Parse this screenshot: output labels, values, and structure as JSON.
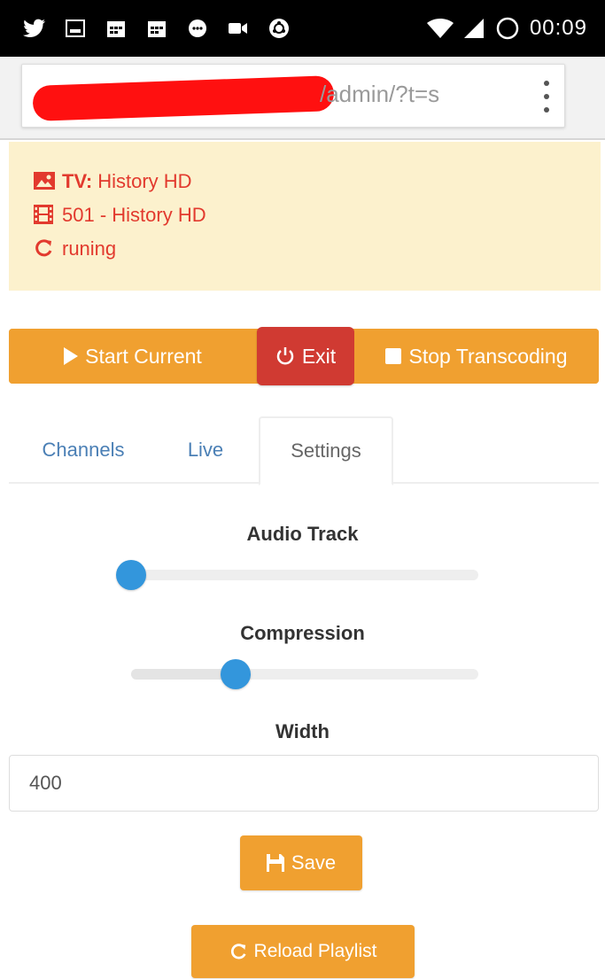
{
  "status_bar": {
    "time": "00:09",
    "left_icons": [
      "twitter-icon",
      "gallery-icon",
      "calendar-icon",
      "calendar-icon",
      "chat-icon",
      "video-icon",
      "ubuntu-icon"
    ],
    "right_icons": [
      "wifi-icon",
      "signal-icon",
      "sync-icon"
    ]
  },
  "browser": {
    "url_visible": "/admin/?t=s",
    "menu_icon": "overflow-menu-icon"
  },
  "info_panel": {
    "tv_label": "TV:",
    "tv_value": "History HD",
    "channel": "501 - History HD",
    "status": "runing",
    "text_color": "#e23a2e",
    "background": "#fcf1cd"
  },
  "actions": {
    "start_label": "Start Current",
    "exit_label": "Exit",
    "stop_label": "Stop Transcoding",
    "accent": "#f0a030",
    "danger": "#d03a32"
  },
  "tabs": {
    "channels": "Channels",
    "live": "Live",
    "settings": "Settings",
    "active": "Settings"
  },
  "settings": {
    "audio_track_label": "Audio Track",
    "audio_track_level": 0.0,
    "compression_label": "Compression",
    "compression_level": 0.3,
    "width_label": "Width",
    "width_value": "400",
    "save_label": "Save",
    "reload_label": "Reload Playlist",
    "knob_color": "#3396dc"
  }
}
